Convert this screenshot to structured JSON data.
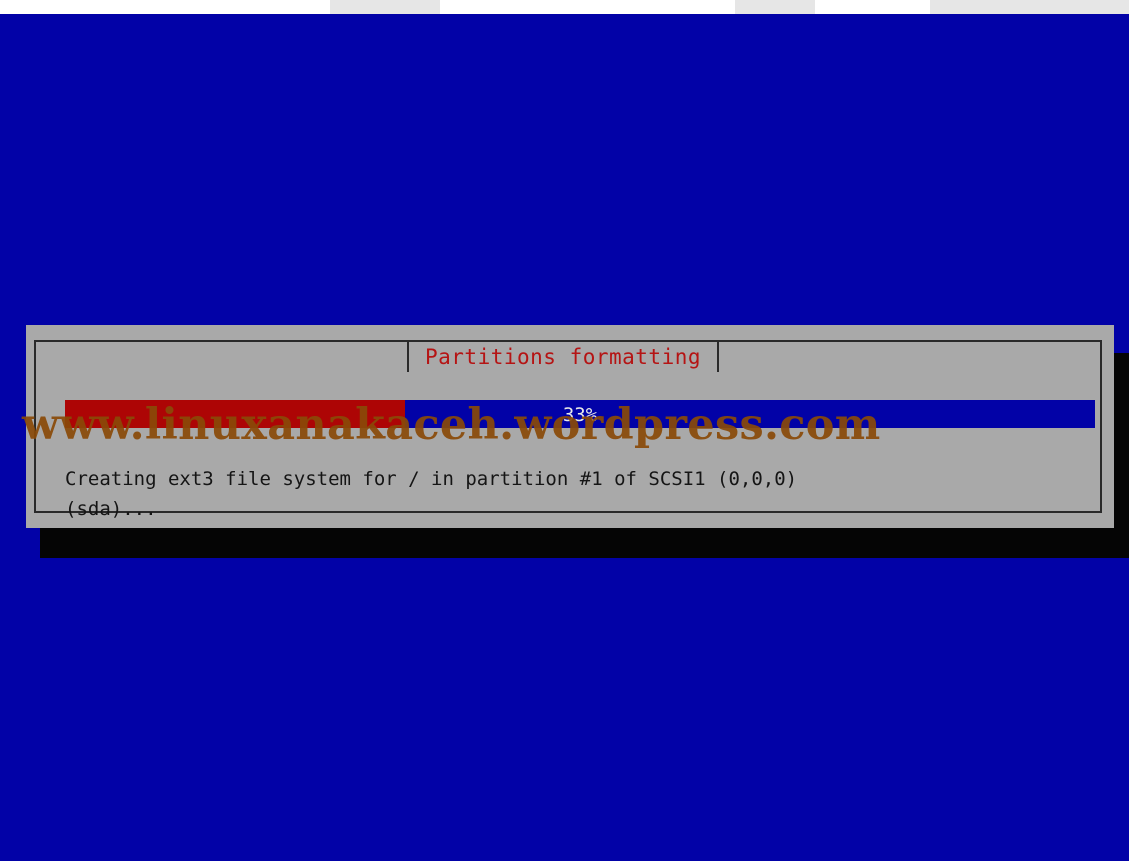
{
  "installer": {
    "dialog_title": "Partitions formatting",
    "progress": {
      "percent": 33,
      "label": "33%"
    },
    "message_line1": "Creating ext3 file system for / in partition #1 of SCSI1 (0,0,0)",
    "message_line2": "(sda)..."
  },
  "watermark": {
    "text": "www.linuxanakaceh.wordpress.com"
  },
  "colors": {
    "background": "#0202a7",
    "dialog": "#a9a9a9",
    "progress_fill": "#ad0505",
    "title_text": "#b51414",
    "watermark": "#8a4a08"
  }
}
